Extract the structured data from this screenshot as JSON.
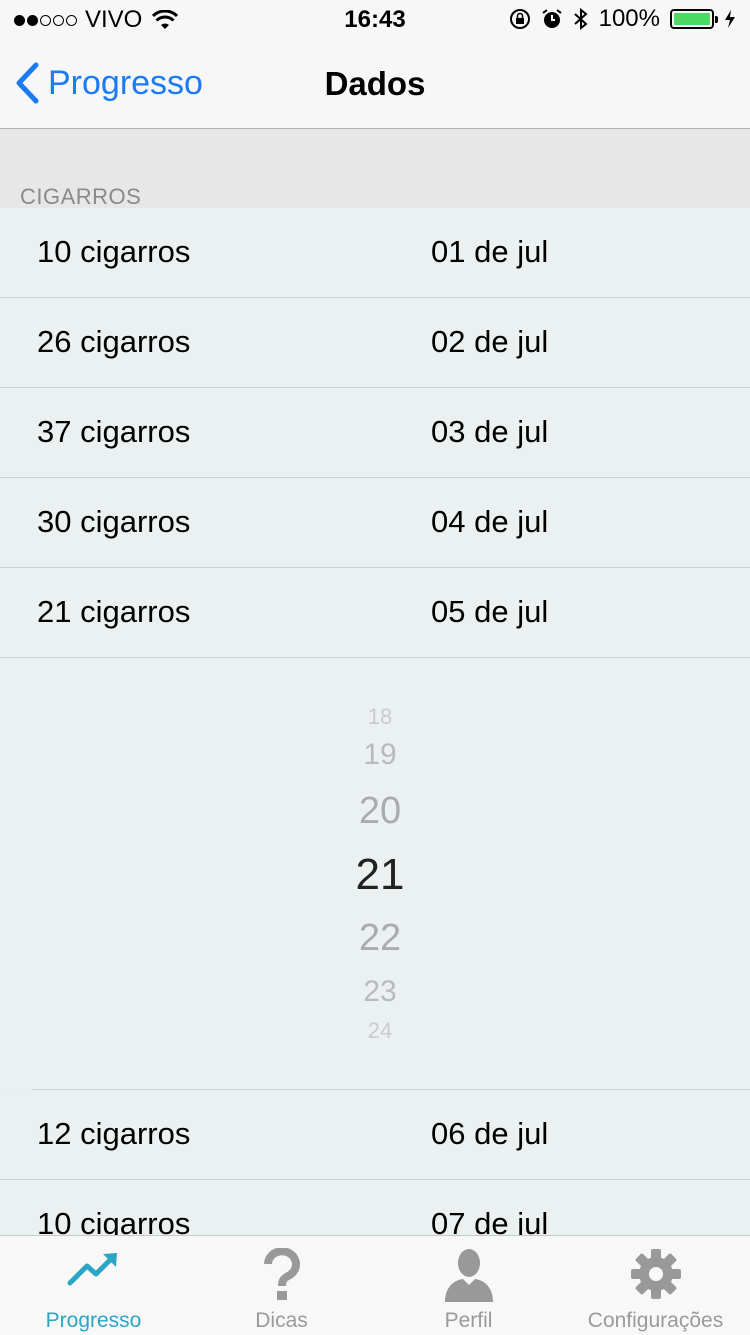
{
  "status_bar": {
    "carrier": "VIVO",
    "time": "16:43",
    "battery": "100%"
  },
  "nav": {
    "back_label": "Progresso",
    "title": "Dados"
  },
  "section": {
    "header": "CIGARROS"
  },
  "rows": [
    {
      "amount": "10 cigarros",
      "date": "01 de jul"
    },
    {
      "amount": "26 cigarros",
      "date": "02 de jul"
    },
    {
      "amount": "37 cigarros",
      "date": "03 de jul"
    },
    {
      "amount": "30 cigarros",
      "date": "04 de jul"
    },
    {
      "amount": "21 cigarros",
      "date": "05 de jul"
    },
    {
      "amount": "12 cigarros",
      "date": "06 de jul"
    },
    {
      "amount": "10 cigarros",
      "date": "07 de jul"
    }
  ],
  "picker": {
    "selected": "21",
    "items": [
      "18",
      "19",
      "20",
      "21",
      "22",
      "23",
      "24"
    ]
  },
  "tabs": [
    {
      "label": "Progresso",
      "icon": "trend-up-icon"
    },
    {
      "label": "Dicas",
      "icon": "question-icon"
    },
    {
      "label": "Perfil",
      "icon": "person-icon"
    },
    {
      "label": "Configurações",
      "icon": "gear-icon"
    }
  ],
  "colors": {
    "accent": "#1a7bf5",
    "tab_active": "#2aa6c4",
    "battery": "#4cd964"
  }
}
